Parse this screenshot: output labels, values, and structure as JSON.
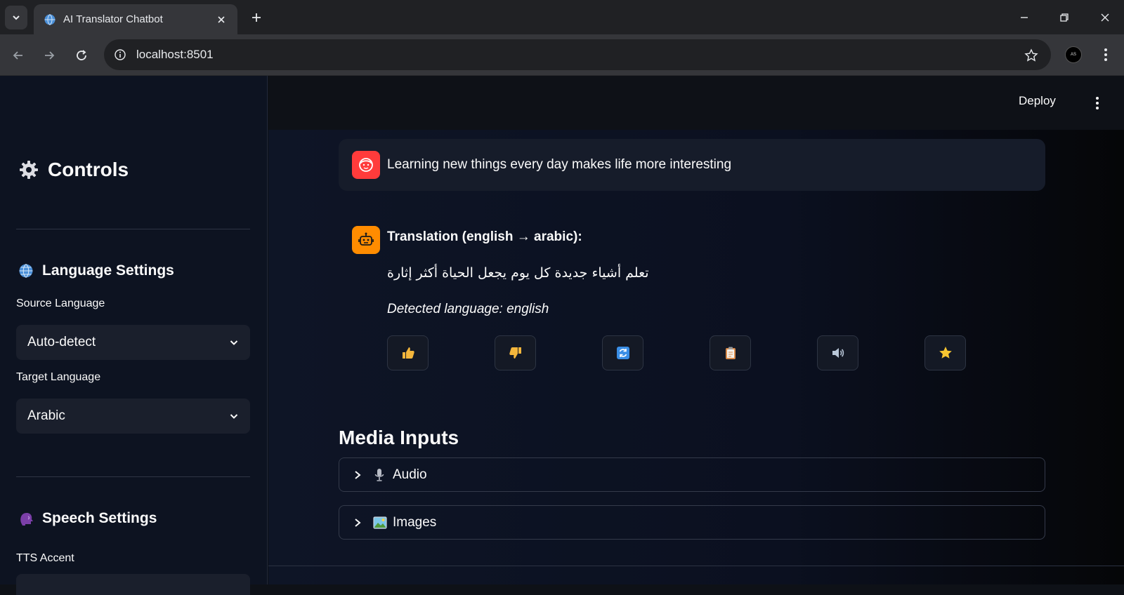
{
  "browser": {
    "tab_title": "AI Translator Chatbot",
    "url": "localhost:8501",
    "profile_initials": "AS"
  },
  "sidebar": {
    "title": "Controls",
    "language_settings": {
      "heading": "Language Settings",
      "source_label": "Source Language",
      "source_value": "Auto-detect",
      "target_label": "Target Language",
      "target_value": "Arabic"
    },
    "speech_settings": {
      "heading": "Speech Settings",
      "tts_label": "TTS Accent"
    }
  },
  "header": {
    "deploy_label": "Deploy"
  },
  "chat": {
    "user_message": "Learning new things every day makes life more interesting",
    "bot_title": "Translation (english → arabic):",
    "bot_translation": "تعلم أشياء جديدة كل يوم يجعل الحياة أكثر إثارة",
    "bot_detected": "Detected language: english",
    "actions": [
      {
        "name": "thumbs-up",
        "icon": "thumbs-up-icon"
      },
      {
        "name": "thumbs-down",
        "icon": "thumbs-down-icon"
      },
      {
        "name": "refresh",
        "icon": "refresh-icon"
      },
      {
        "name": "copy",
        "icon": "clipboard-icon"
      },
      {
        "name": "speak",
        "icon": "speaker-icon"
      },
      {
        "name": "favorite",
        "icon": "star-icon"
      }
    ]
  },
  "media": {
    "heading": "Media Inputs",
    "audio_label": "Audio",
    "images_label": "Images"
  },
  "colors": {
    "user_avatar": "#ff3b3b",
    "bot_avatar": "#ff8c00",
    "background": "#0e1117"
  }
}
